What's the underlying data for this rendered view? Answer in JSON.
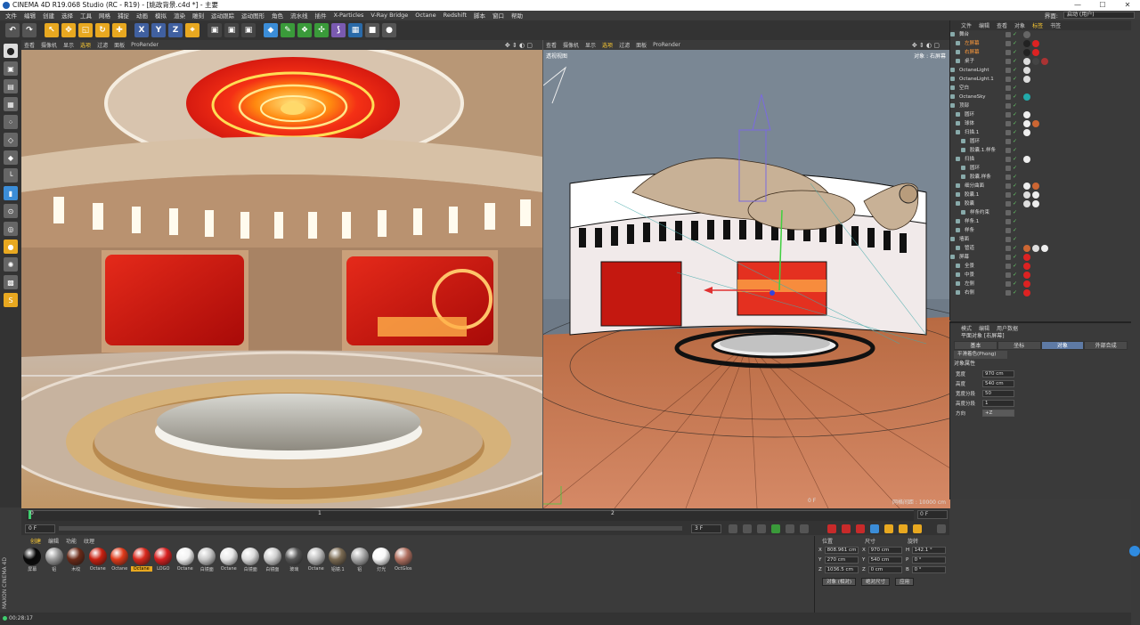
{
  "window": {
    "title": "CINEMA 4D R19.068 Studio (RC - R19) - [姚政背景.c4d *] - 主要"
  },
  "menu": [
    "文件",
    "编辑",
    "创建",
    "选择",
    "工具",
    "网格",
    "捕捉",
    "动画",
    "模拟",
    "渲染",
    "雕刻",
    "运动跟踪",
    "运动图形",
    "角色",
    "流水线",
    "插件",
    "X-Particles",
    "V-Ray Bridge",
    "Octane",
    "Redshift",
    "脚本",
    "窗口",
    "帮助"
  ],
  "layout": {
    "label": "界面:",
    "value": "启动 (用户)"
  },
  "viewport_menu": [
    "查看",
    "摄像机",
    "显示",
    "选项",
    "过滤",
    "面板",
    "ProRender"
  ],
  "viewport2": {
    "camera": "透视视图",
    "object": "对象 : 右屏幕",
    "frame": "0 F",
    "grid": "网格间距 : 10000 cm"
  },
  "object_manager": {
    "menu": [
      "文件",
      "编辑",
      "查看",
      "对象",
      "标签",
      "书签"
    ],
    "rows": [
      {
        "name": "舞台",
        "indent": 4,
        "tags": [
          "#666"
        ]
      },
      {
        "name": "左屏幕",
        "indent": 10,
        "tags": [
          "#222",
          "#d22"
        ],
        "hl": true
      },
      {
        "name": "右屏幕",
        "indent": 10,
        "tags": [
          "#222",
          "#d22"
        ],
        "hl": true
      },
      {
        "name": "桌子",
        "indent": 10,
        "tags": [
          "#ddd",
          "#444",
          "#a33"
        ]
      },
      {
        "name": "OctaneLight",
        "indent": 4,
        "tags": [
          "#ddd"
        ]
      },
      {
        "name": "OctaneLight.1",
        "indent": 4,
        "tags": [
          "#ddd"
        ]
      },
      {
        "name": "空白",
        "indent": 4,
        "tags": []
      },
      {
        "name": "OctaneSky",
        "indent": 4,
        "tags": [
          "#2aa"
        ]
      },
      {
        "name": "顶部",
        "indent": 4,
        "tags": []
      },
      {
        "name": "圆环",
        "indent": 10,
        "tags": [
          "#eee"
        ]
      },
      {
        "name": "球体",
        "indent": 10,
        "tags": [
          "#eee",
          "#c63"
        ]
      },
      {
        "name": "扫描.1",
        "indent": 10,
        "tags": [
          "#eee"
        ]
      },
      {
        "name": "圆环",
        "indent": 16,
        "tags": []
      },
      {
        "name": "胶囊.1.样条",
        "indent": 16,
        "tags": []
      },
      {
        "name": "扫描",
        "indent": 10,
        "tags": [
          "#eee"
        ]
      },
      {
        "name": "圆环",
        "indent": 16,
        "tags": []
      },
      {
        "name": "胶囊.样条",
        "indent": 16,
        "tags": []
      },
      {
        "name": "细分曲面",
        "indent": 10,
        "tags": [
          "#eee",
          "#c63"
        ]
      },
      {
        "name": "胶囊.1",
        "indent": 10,
        "tags": [
          "#ddd",
          "#eee"
        ]
      },
      {
        "name": "胶囊",
        "indent": 10,
        "tags": [
          "#ddd",
          "#eee"
        ]
      },
      {
        "name": "样条约束",
        "indent": 16,
        "tags": []
      },
      {
        "name": "样条.1",
        "indent": 10,
        "tags": []
      },
      {
        "name": "样条",
        "indent": 10,
        "tags": []
      },
      {
        "name": "墙面",
        "indent": 4,
        "tags": []
      },
      {
        "name": "管道",
        "indent": 10,
        "tags": [
          "#c63",
          "#ddd",
          "#eee"
        ]
      },
      {
        "name": "屏幕",
        "indent": 4,
        "tags": [
          "#d22"
        ]
      },
      {
        "name": "全景",
        "indent": 10,
        "tags": [
          "#d22"
        ]
      },
      {
        "name": "中景",
        "indent": 10,
        "tags": [
          "#d22"
        ]
      },
      {
        "name": "左侧",
        "indent": 10,
        "tags": [
          "#d22"
        ]
      },
      {
        "name": "右侧",
        "indent": 10,
        "tags": [
          "#d22"
        ]
      }
    ]
  },
  "attributes": {
    "menu": [
      "模式",
      "编辑",
      "用户数据"
    ],
    "title": "平面对象 [右屏幕]",
    "tabs": [
      "基本",
      "坐标",
      "对象",
      "外部合成"
    ],
    "active_tab": "对象",
    "shading": "平滑着色(Phong)",
    "section": "对象属性",
    "props": [
      {
        "label": "宽度",
        "value": "970 cm"
      },
      {
        "label": "高度",
        "value": "540 cm"
      },
      {
        "label": "宽度分段",
        "value": "50"
      },
      {
        "label": "高度分段",
        "value": "1"
      },
      {
        "label": "方向",
        "value": "+Z",
        "sel": true
      }
    ]
  },
  "timeline": {
    "ticks": [
      "0",
      "1",
      "2"
    ],
    "end": "0 F"
  },
  "transport": {
    "start": "0 F",
    "end": "3 F"
  },
  "material_manager": {
    "menu": [
      "创建",
      "编辑",
      "功能",
      "纹理"
    ],
    "active": "创建",
    "materials": [
      {
        "name": "屏幕",
        "color": "#080808"
      },
      {
        "name": "铝",
        "color": "#9a9a9a"
      },
      {
        "name": "木纹",
        "color": "#6a2a18"
      },
      {
        "name": "Octane",
        "color": "#c82010"
      },
      {
        "name": "Octane",
        "color": "#e03a1a"
      },
      {
        "name": "Octane",
        "color": "#d8281c",
        "sel": true
      },
      {
        "name": "LOGO",
        "color": "#d82020"
      },
      {
        "name": "Octane",
        "color": "#f2f2f2"
      },
      {
        "name": "白镜面",
        "color": "#c8c8c8"
      },
      {
        "name": "Octane",
        "color": "#e8e8e8"
      },
      {
        "name": "白镜面",
        "color": "#dcdcdc"
      },
      {
        "name": "白镜面",
        "color": "#cfcfcf"
      },
      {
        "name": "玻璃",
        "color": "#555555"
      },
      {
        "name": "Octane",
        "color": "#bdbdbd"
      },
      {
        "name": "铝镜.1",
        "color": "#7a6a52"
      },
      {
        "name": "铝",
        "color": "#aaaaaa"
      },
      {
        "name": "灯光",
        "color": "#f8f8f8"
      },
      {
        "name": "OctGlos",
        "color": "#b07060"
      }
    ]
  },
  "coordinates": {
    "headers": [
      "位置",
      "尺寸",
      "旋转"
    ],
    "rows": [
      [
        "X",
        "808.961 cm",
        "X",
        "970 cm",
        "H",
        "142.1 °"
      ],
      [
        "Y",
        "270 cm",
        "Y",
        "540 cm",
        "P",
        "0 °"
      ],
      [
        "Z",
        "1036.5 cm",
        "Z",
        "0 cm",
        "B",
        "0 °"
      ]
    ],
    "mode": "对象 (相对)",
    "size_mode": "绝对尺寸",
    "apply": "应用"
  },
  "status": {
    "time": "00:28:17"
  },
  "brand": "MAXON CINEMA 4D",
  "colors": {
    "accent": "#ffcc33",
    "selection": "#5e7aa5",
    "bg": "#3b3b3b"
  }
}
